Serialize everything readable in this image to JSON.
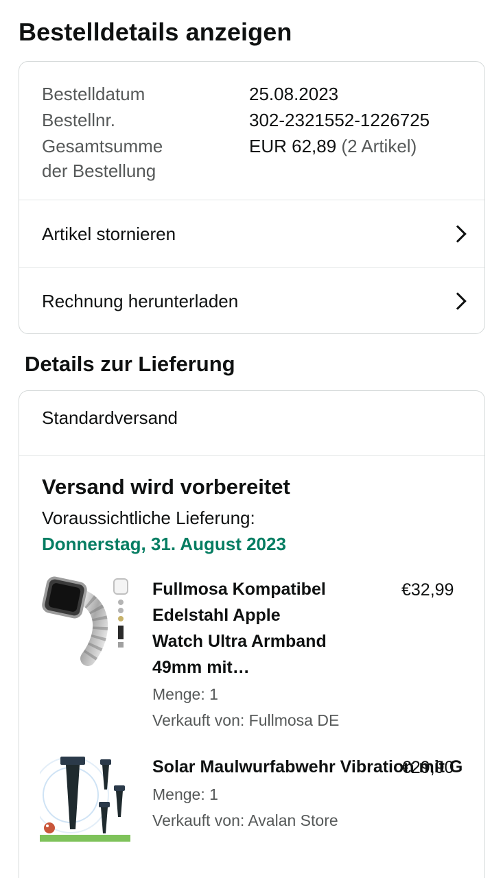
{
  "page": {
    "title": "Bestelldetails anzeigen"
  },
  "summary": {
    "order_date_label": "Bestelldatum",
    "order_date_value": "25.08.2023",
    "order_number_label": "Bestellnr.",
    "order_number_value": "302-2321552-1226725",
    "total_label_line1": "Gesamtsumme",
    "total_label_line2": "der Bestellung",
    "total_value": "EUR 62,89",
    "total_items": "(2 Artikel)"
  },
  "actions": [
    {
      "label": "Artikel stornieren",
      "icon": "chevron-right-icon"
    },
    {
      "label": "Rechnung herunterladen",
      "icon": "chevron-right-icon"
    }
  ],
  "delivery": {
    "section_title": "Details zur Lieferung",
    "shipping_method": "Standardversand",
    "status": "Versand wird vorbereitet",
    "eta_label": "Voraussichtliche Lieferung:",
    "eta_date": "Donnerstag, 31. August 2023",
    "eta_color": "#067d62"
  },
  "items": [
    {
      "title_lines": [
        "Fullmosa Kompatibel",
        "Edelstahl Apple",
        "Watch Ultra Armband",
        "49mm mit…"
      ],
      "price": "€32,99",
      "quantity": "Menge: 1",
      "seller": "Verkauft von: Fullmosa DE",
      "image": "watch-band-image"
    },
    {
      "title": "Solar Maulwurfabwehr Vibration mit G",
      "price": "€29,90",
      "quantity": "Menge: 1",
      "seller": "Verkauft von: Avalan Store",
      "image": "mole-repeller-image"
    }
  ]
}
